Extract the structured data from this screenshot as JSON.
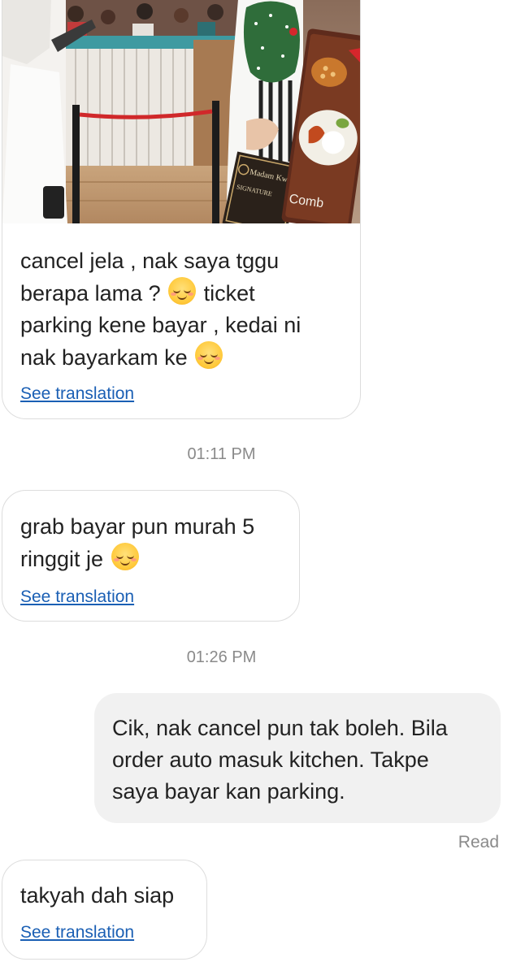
{
  "messages": [
    {
      "direction": "incoming",
      "has_photo": true,
      "lines": [
        "cancel jela , nak saya tggu",
        "berapa lama ?",
        "ticket",
        "parking kene bayar , kedai ni",
        "nak bayarkam ke"
      ],
      "see_translation": "See translation"
    },
    {
      "timestamp": "01:11 PM"
    },
    {
      "direction": "incoming",
      "lines": [
        "grab bayar pun murah 5",
        "ringgit je"
      ],
      "see_translation": "See translation"
    },
    {
      "timestamp": "01:26 PM"
    },
    {
      "direction": "outgoing",
      "text": "Cik, nak cancel pun tak boleh. Bila\norder auto masuk kitchen. Takpe\nsaya bayar kan parking.",
      "receipt": "Read"
    },
    {
      "direction": "incoming",
      "text": "takyah dah siap",
      "see_translation": "See translation"
    }
  ],
  "photo": {
    "sign_text": "Madam Kwan's",
    "sign_subtext": "SIGNATURE",
    "menu_text": "Comb"
  },
  "emoji_icon": "relieved-face-emoji",
  "colors": {
    "link": "#1a5fb4",
    "timestamp": "#8a8a8a",
    "outgoing_bubble": "#f1f1f1"
  }
}
